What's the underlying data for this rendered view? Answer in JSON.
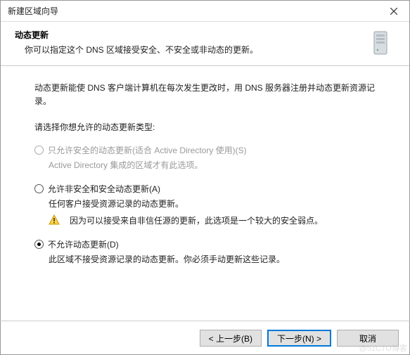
{
  "titlebar": {
    "title": "新建区域向导"
  },
  "header": {
    "title": "动态更新",
    "desc": "你可以指定这个 DNS 区域接受安全、不安全或非动态的更新。"
  },
  "content": {
    "intro": "动态更新能使 DNS 客户端计算机在每次发生更改时，用 DNS 服务器注册并动态更新资源记录。",
    "prompt": "请选择你想允许的动态更新类型:"
  },
  "options": {
    "secure": {
      "label": "只允许安全的动态更新(适合 Active Directory 使用)(S)",
      "desc": "Active Directory 集成的区域才有此选项。",
      "disabled": true,
      "selected": false
    },
    "nonsecure": {
      "label": "允许非安全和安全动态更新(A)",
      "desc": "任何客户接受资源记录的动态更新。",
      "warning": "因为可以接受来自非信任源的更新，此选项是一个较大的安全弱点。",
      "selected": false
    },
    "none": {
      "label": "不允许动态更新(D)",
      "desc": "此区域不接受资源记录的动态更新。你必须手动更新这些记录。",
      "selected": true
    }
  },
  "buttons": {
    "back": "< 上一步(B)",
    "next": "下一步(N) >",
    "cancel": "取消"
  },
  "watermark": "@51CTO博客"
}
